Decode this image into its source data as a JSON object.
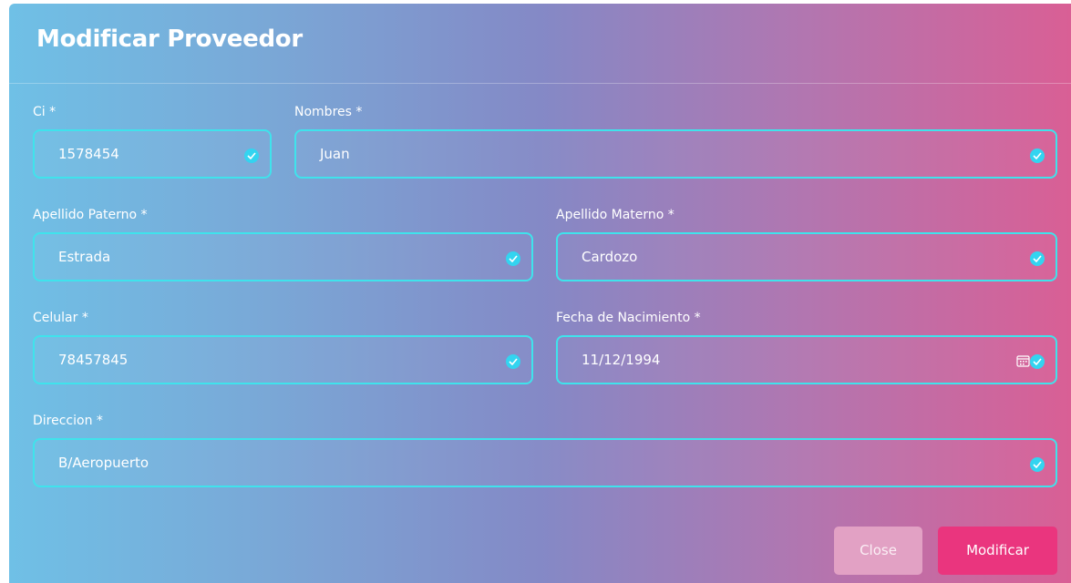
{
  "modal": {
    "title": "Modificar Proveedor"
  },
  "form": {
    "ci": {
      "label": "Ci *",
      "value": "1578454"
    },
    "nombres": {
      "label": "Nombres *",
      "value": "Juan"
    },
    "apellido_paterno": {
      "label": "Apellido Paterno *",
      "value": "Estrada"
    },
    "apellido_materno": {
      "label": "Apellido Materno *",
      "value": "Cardozo"
    },
    "celular": {
      "label": "Celular *",
      "value": "78457845"
    },
    "fecha_nacimiento": {
      "label": "Fecha de Nacimiento *",
      "value": "11/12/1994"
    },
    "direccion": {
      "label": "Direccion *",
      "value": "B/Aeropuerto"
    }
  },
  "buttons": {
    "close_label": "Close",
    "modify_label": "Modificar"
  },
  "icons": {
    "valid": "check-circle-icon",
    "date": "calendar-icon"
  },
  "colors": {
    "field_border": "#3fe3ec",
    "check": "#33d4f0",
    "primary_button": "#ea357e",
    "close_button": "#e2a1c4"
  }
}
